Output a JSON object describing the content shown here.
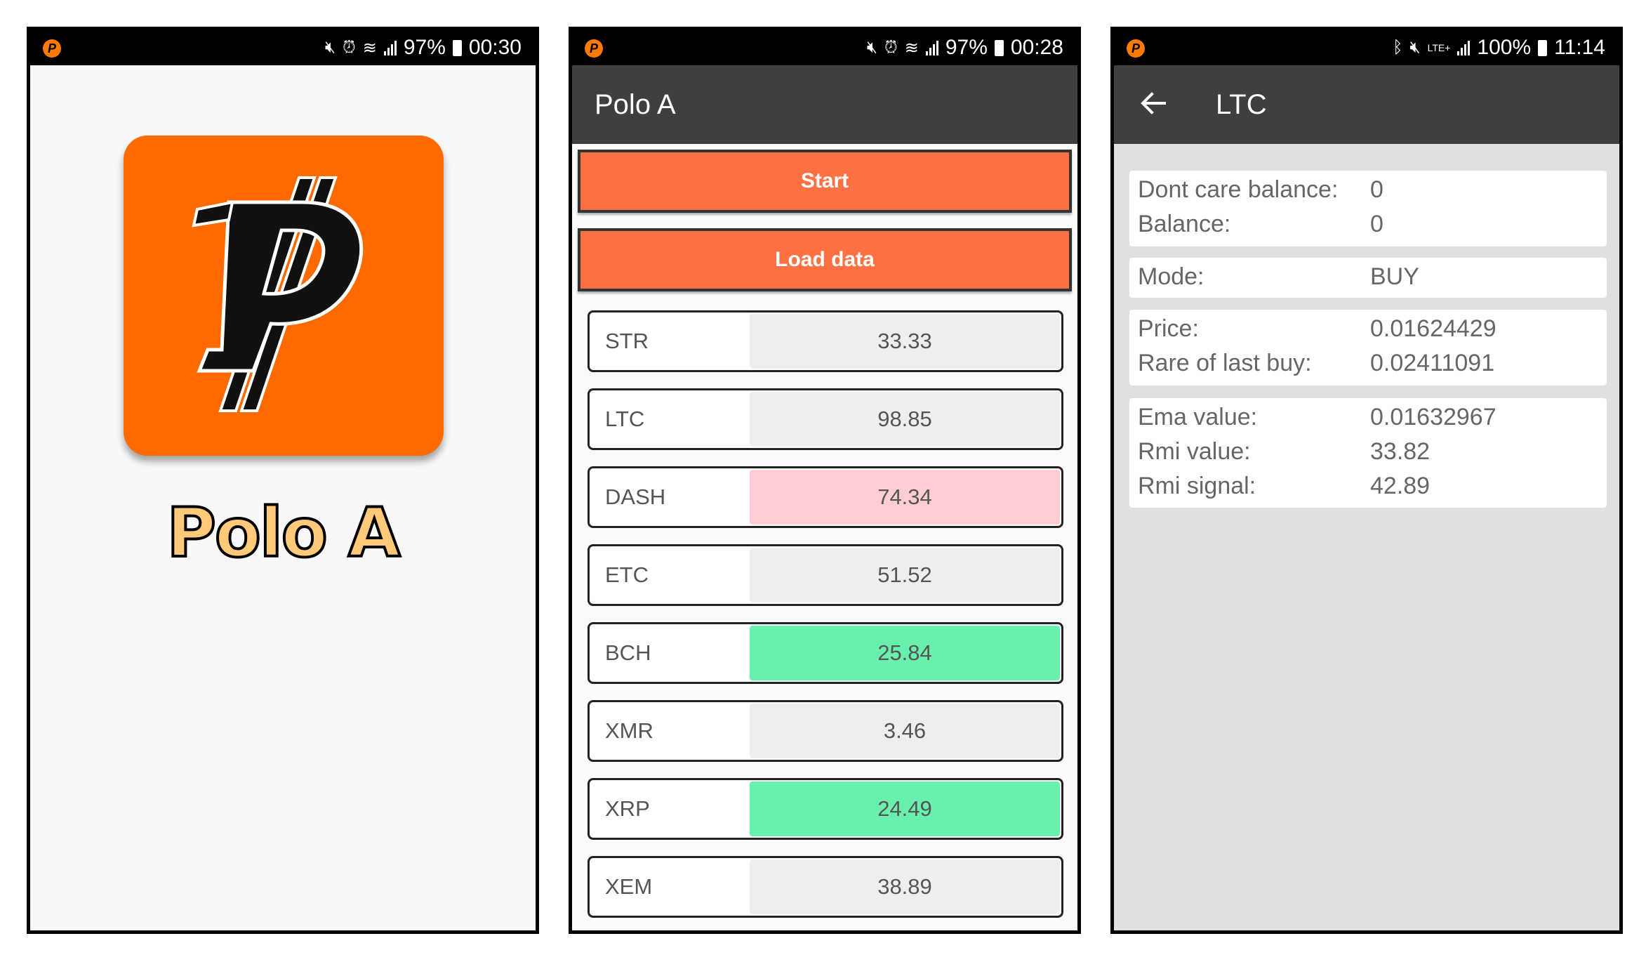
{
  "screens": {
    "splash": {
      "status": {
        "battery": "97%",
        "time": "00:30"
      },
      "app_name": "Polo A"
    },
    "main": {
      "status": {
        "battery": "97%",
        "time": "00:28"
      },
      "title": "Polo A",
      "start_label": "Start",
      "load_label": "Load data",
      "coins": [
        {
          "symbol": "STR",
          "value": "33.33",
          "color": "#eeeeee"
        },
        {
          "symbol": "LTC",
          "value": "98.85",
          "color": "#eeeeee"
        },
        {
          "symbol": "DASH",
          "value": "74.34",
          "color": "#ffcdd2"
        },
        {
          "symbol": "ETC",
          "value": "51.52",
          "color": "#eeeeee"
        },
        {
          "symbol": "BCH",
          "value": "25.84",
          "color": "#69f0ae"
        },
        {
          "symbol": "XMR",
          "value": "3.46",
          "color": "#eeeeee"
        },
        {
          "symbol": "XRP",
          "value": "24.49",
          "color": "#69f0ae"
        },
        {
          "symbol": "XEM",
          "value": "38.89",
          "color": "#eeeeee"
        }
      ]
    },
    "detail": {
      "status": {
        "battery": "100%",
        "time": "11:14"
      },
      "title": "LTC",
      "fields": {
        "dont_care_balance": {
          "label": "Dont care balance:",
          "value": "0"
        },
        "balance": {
          "label": "Balance:",
          "value": "0"
        },
        "mode": {
          "label": "Mode:",
          "value": "BUY"
        },
        "price": {
          "label": "Price:",
          "value": "0.01624429"
        },
        "rare_of_last_buy": {
          "label": "Rare of last buy:",
          "value": "0.02411091"
        },
        "ema_value": {
          "label": "Ema value:",
          "value": "0.01632967"
        },
        "rmi_value": {
          "label": "Rmi value:",
          "value": "33.82"
        },
        "rmi_signal": {
          "label": "Rmi signal:",
          "value": "42.89"
        }
      }
    }
  },
  "colors": {
    "accent": "#ff7043",
    "toolbar": "#3f3f3f",
    "logo": "#ff6a00"
  }
}
